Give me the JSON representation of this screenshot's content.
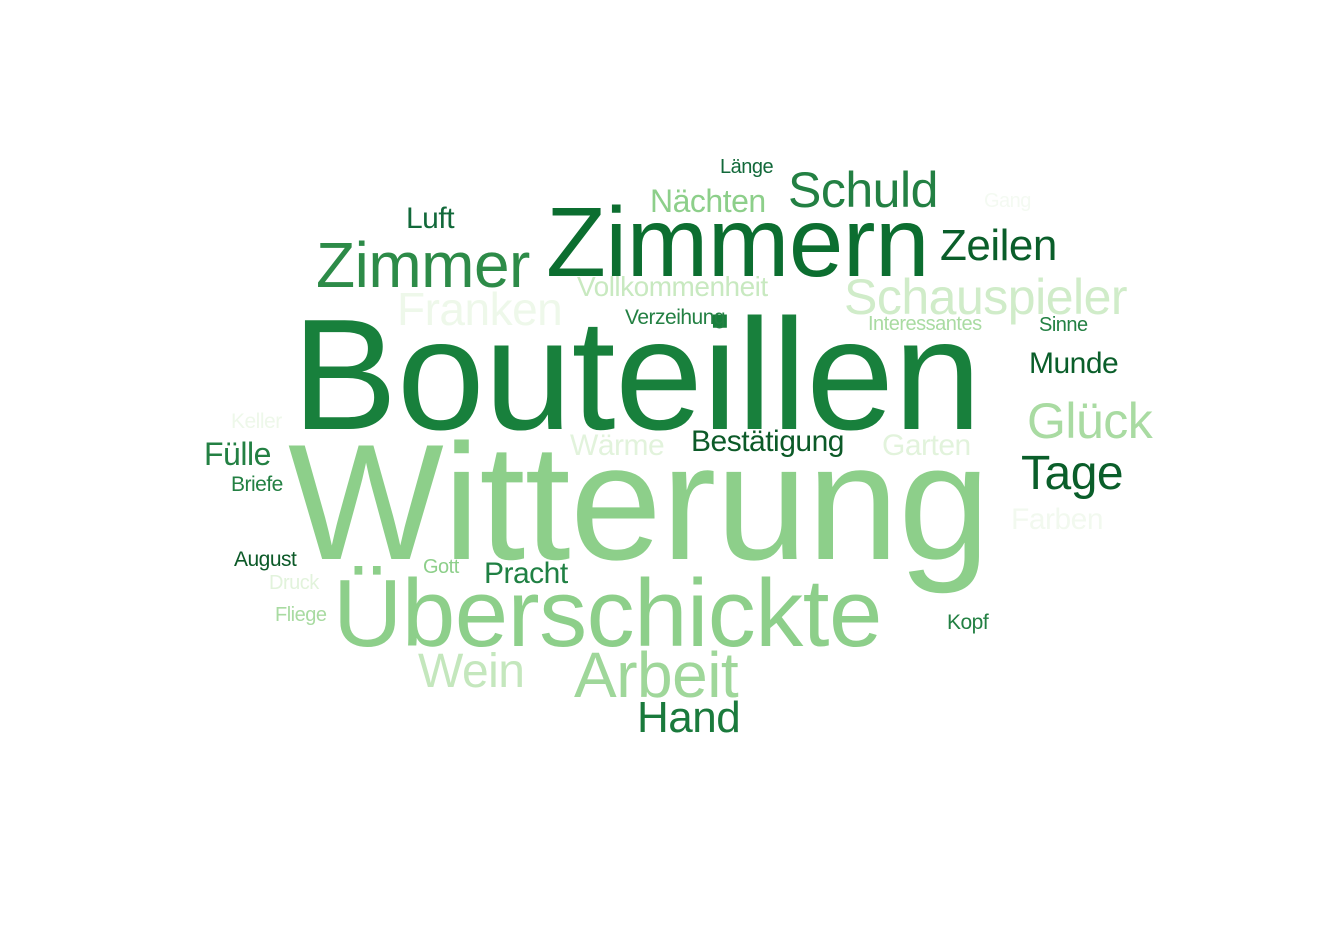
{
  "words": [
    {
      "text": "Bouteillen",
      "color": "#18803c"
    },
    {
      "text": "Witterung",
      "color": "#8dcf8a"
    },
    {
      "text": "Zimmern",
      "color": "#0c6e30"
    },
    {
      "text": "Überschickte",
      "color": "#8dcf8a"
    },
    {
      "text": "Zimmer",
      "color": "#2d8b48"
    },
    {
      "text": "Arbeit",
      "color": "#9fd79a"
    },
    {
      "text": "Schauspieler",
      "color": "#d0ecc9"
    },
    {
      "text": "Schuld",
      "color": "#238043"
    },
    {
      "text": "Zeilen",
      "color": "#0a5e2a"
    },
    {
      "text": "Franken",
      "color": "#eef8ea"
    },
    {
      "text": "Glück",
      "color": "#a9dba2"
    },
    {
      "text": "Tage",
      "color": "#0a5e2a"
    },
    {
      "text": "Wein",
      "color": "#c4e7bd"
    },
    {
      "text": "Hand",
      "color": "#1a7a3c"
    },
    {
      "text": "Nächten",
      "color": "#8dcf8a"
    },
    {
      "text": "Vollkommenheit",
      "color": "#c8e9c0"
    },
    {
      "text": "Mundе",
      "color": "#0a5e2a"
    },
    {
      "text": "Bestätigung",
      "color": "#0c5a28"
    },
    {
      "text": "Wärme",
      "color": "#e2f3dc"
    },
    {
      "text": "Garten",
      "color": "#e2f3dc"
    },
    {
      "text": "Luft",
      "color": "#12693a"
    },
    {
      "text": "Fülle",
      "color": "#238043"
    },
    {
      "text": "Pracht",
      "color": "#1f8043"
    },
    {
      "text": "Farben",
      "color": "#f2f9ef"
    },
    {
      "text": "Verzeihung",
      "color": "#238043"
    },
    {
      "text": "Interessantes",
      "color": "#a9dba2"
    },
    {
      "text": "Sinne",
      "color": "#238043"
    },
    {
      "text": "Länge",
      "color": "#12693a"
    },
    {
      "text": "Gang",
      "color": "#f4faf2"
    },
    {
      "text": "Keller",
      "color": "#eef8ea"
    },
    {
      "text": "Briefe",
      "color": "#238043"
    },
    {
      "text": "August",
      "color": "#0c5a28"
    },
    {
      "text": "Gott",
      "color": "#8dcf8a"
    },
    {
      "text": "Druck",
      "color": "#e2f3dc"
    },
    {
      "text": "Fliege",
      "color": "#a9dba2"
    },
    {
      "text": "Kopf",
      "color": "#238043"
    }
  ]
}
